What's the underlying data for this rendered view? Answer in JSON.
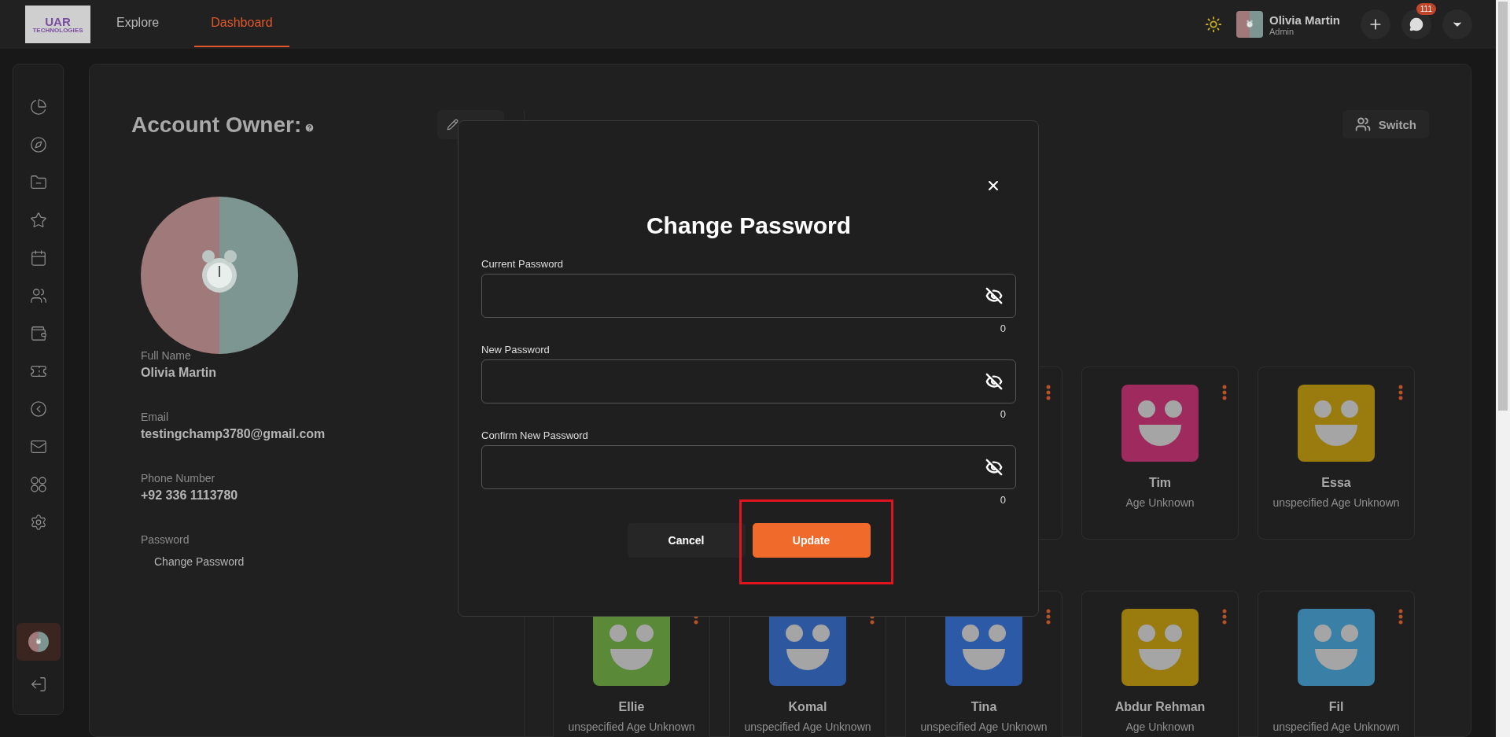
{
  "header": {
    "logo": {
      "mark": "UAR",
      "name": "TECHNOLOGIES"
    },
    "tabs": [
      {
        "label": "Explore",
        "selected": false
      },
      {
        "label": "Dashboard",
        "selected": true
      }
    ],
    "user": {
      "name": "Olivia Martin",
      "role": "Admin"
    },
    "messages_badge": "111"
  },
  "sidebar": {
    "items": [
      {
        "selected": false
      },
      {
        "selected": false
      },
      {
        "selected": false
      },
      {
        "selected": false
      },
      {
        "selected": false
      },
      {
        "selected": false
      },
      {
        "selected": false
      },
      {
        "selected": false
      },
      {
        "selected": false
      },
      {
        "selected": false
      },
      {
        "selected": false
      },
      {
        "selected": false
      }
    ],
    "profile": {
      "selected": true
    }
  },
  "account": {
    "title": "Account Owner:",
    "fields": [
      {
        "label": "Full Name",
        "value": "Olivia Martin"
      },
      {
        "label": "Email",
        "value": "testingchamp3780@gmail.com"
      },
      {
        "label": "Phone Number",
        "value": "+92 336 1113780"
      }
    ],
    "password": {
      "label": "Password",
      "action": "Change Password"
    }
  },
  "viewing": {
    "switch_label": "Switch",
    "rows": [
      [
        "",
        "",
        {
          "kind": "covered"
        },
        {
          "kind": "profile",
          "name": "Tim",
          "detail": "Age Unknown",
          "color": "#9e2a5e"
        },
        {
          "kind": "profile",
          "name": "Essa",
          "detail": "unspecified Age Unknown",
          "color": "#9a7b0e"
        }
      ],
      [
        {
          "kind": "profile",
          "name": "Ellie",
          "detail": "unspecified Age Unknown",
          "color": "#5a8a38"
        },
        {
          "kind": "profile",
          "name": "Komal",
          "detail": "unspecified Age Unknown",
          "color": "#2d58a0"
        },
        {
          "kind": "profile",
          "name": "Tina",
          "detail": "unspecified Age Unknown",
          "color": "#2d5aa6"
        },
        {
          "kind": "profile",
          "name": "Abdur Rehman",
          "detail": "Age Unknown",
          "color": "#9a7b0e"
        },
        {
          "kind": "profile",
          "name": "Fil",
          "detail": "unspecified Age Unknown",
          "color": "#3a80a6"
        }
      ]
    ]
  },
  "dialog": {
    "title": "Change Password",
    "fields": [
      {
        "label": "Current Password",
        "counter": "0"
      },
      {
        "label": "New Password",
        "counter": "0"
      },
      {
        "label": "Confirm New Password",
        "counter": "0"
      }
    ],
    "buttons": [
      {
        "label": "Cancel",
        "kind": "secondary",
        "highlighted": false
      },
      {
        "label": "Update",
        "kind": "primary",
        "highlighted": true
      }
    ]
  }
}
